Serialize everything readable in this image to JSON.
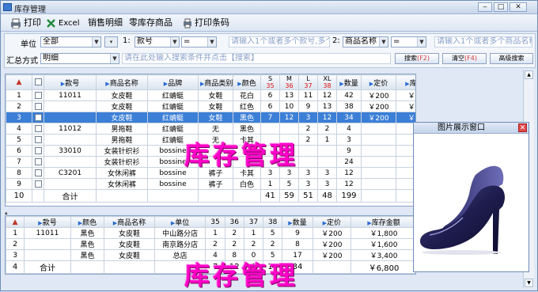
{
  "window": {
    "title": "库存管理",
    "min": "‒",
    "max": "□",
    "close": "✕"
  },
  "toolbar": {
    "print": "打印",
    "excel": "Excel",
    "sales_detail": "销售明细",
    "zero_stock": "零库存商品",
    "print_barcode": "打印条码"
  },
  "filters": {
    "unit_label": "单位",
    "unit_value": "全部",
    "unit_extra": "▾",
    "cond1_index": "1:",
    "cond1_field": "款号",
    "cond1_op": "=",
    "cond1_placeholder": "请输入1个或者多个款号,多个",
    "cond2_index": "2:",
    "cond2_field": "商品名称",
    "cond2_op": "=",
    "cond2_placeholder": "请输入1个或者多个商品名称",
    "summary_label": "汇总方式",
    "summary_value": "明细",
    "summary_placeholder": "请在此处输入搜索条件并点击【搜索】",
    "search_btn": "搜索",
    "search_key": "(F2)",
    "clear_btn": "清空",
    "clear_key": "(F4)",
    "advanced_btn": "高级搜索"
  },
  "top_grid": {
    "headers": {
      "style": "款号",
      "name": "商品名称",
      "brand": "品牌",
      "category": "商品类别",
      "color": "颜色",
      "qty": "数量",
      "price": "定价",
      "amount": "库存金额"
    },
    "size_headers": [
      {
        "label": "S",
        "num": "35"
      },
      {
        "label": "M",
        "num": "36"
      },
      {
        "label": "L",
        "num": "37"
      },
      {
        "label": "XL",
        "num": "38"
      }
    ],
    "rows": [
      {
        "n": "1",
        "style": "11011",
        "name": "女皮鞋",
        "brand": "红蜻蜓",
        "category": "女鞋",
        "color": "花白",
        "s": "6",
        "m": "13",
        "l": "11",
        "xl": "12",
        "qty": "42",
        "price": "￥200",
        "amount": "￥8,400"
      },
      {
        "n": "2",
        "style": "",
        "name": "女皮鞋",
        "brand": "红蜻蜓",
        "category": "女鞋",
        "color": "红色",
        "s": "6",
        "m": "10",
        "l": "9",
        "xl": "13",
        "qty": "38",
        "price": "￥200",
        "amount": "￥7,600"
      },
      {
        "n": "3",
        "style": "",
        "name": "女皮鞋",
        "brand": "红蜻蜓",
        "category": "女鞋",
        "color": "黑色",
        "s": "7",
        "m": "12",
        "l": "3",
        "xl": "12",
        "qty": "34",
        "price": "￥200",
        "amount": "￥6,800"
      },
      {
        "n": "4",
        "style": "11012",
        "name": "男拖鞋",
        "brand": "红蜻蜓",
        "category": "无",
        "color": "黑色",
        "s": "",
        "m": "",
        "l": "2",
        "xl": "2",
        "qty": "4",
        "price": "",
        "amount": ""
      },
      {
        "n": "5",
        "style": "",
        "name": "男拖鞋",
        "brand": "红蜻蜓",
        "category": "无",
        "color": "卡其",
        "s": "",
        "m": "",
        "l": "2",
        "xl": "1",
        "qty": "3",
        "price": "",
        "amount": ""
      },
      {
        "n": "6",
        "style": "33010",
        "name": "女装针织衫",
        "brand": "bossine",
        "category": "",
        "color": "",
        "s": "",
        "m": "",
        "l": "",
        "xl": "",
        "qty": "9",
        "price": "",
        "amount": ""
      },
      {
        "n": "7",
        "style": "",
        "name": "女装针织衫",
        "brand": "bossine",
        "category": "",
        "color": "",
        "s": "",
        "m": "",
        "l": "",
        "xl": "",
        "qty": "24",
        "price": "",
        "amount": ""
      },
      {
        "n": "8",
        "style": "C3201",
        "name": "女休闲裤",
        "brand": "bossine",
        "category": "裤子",
        "color": "卡其",
        "s": "3",
        "m": "3",
        "l": "3",
        "xl": "3",
        "qty": "12",
        "price": "",
        "amount": ""
      },
      {
        "n": "9",
        "style": "",
        "name": "女休闲裤",
        "brand": "bossine",
        "category": "裤子",
        "color": "白色",
        "s": "1",
        "m": "5",
        "l": "3",
        "xl": "3",
        "qty": "12",
        "price": "",
        "amount": ""
      },
      {
        "n": "10",
        "style": "合计",
        "name": "",
        "brand": "",
        "category": "",
        "color": "",
        "s": "41",
        "m": "59",
        "l": "51",
        "xl": "48",
        "qty": "199",
        "price": "",
        "amount": ""
      }
    ]
  },
  "bottom_grid": {
    "headers": {
      "style": "款号",
      "color": "颜色",
      "name": "商品名称",
      "unit": "单位",
      "s35": "35",
      "s36": "36",
      "s37": "37",
      "s38": "38",
      "qty": "数量",
      "price": "定价",
      "amount": "库存金额"
    },
    "rows": [
      {
        "n": "1",
        "style": "11011",
        "color": "黑色",
        "name": "女皮鞋",
        "unit": "中山路分店",
        "s35": "1",
        "s36": "2",
        "s37": "1",
        "s38": "5",
        "qty": "9",
        "price": "￥200",
        "amount": "￥1,800"
      },
      {
        "n": "2",
        "style": "",
        "color": "黑色",
        "name": "女皮鞋",
        "unit": "南京路分店",
        "s35": "2",
        "s36": "2",
        "s37": "2",
        "s38": "2",
        "qty": "8",
        "price": "￥200",
        "amount": "￥1,600"
      },
      {
        "n": "3",
        "style": "",
        "color": "黑色",
        "name": "女皮鞋",
        "unit": "总店",
        "s35": "4",
        "s36": "8",
        "s37": "0",
        "s38": "5",
        "qty": "17",
        "price": "￥200",
        "amount": "￥3,400"
      },
      {
        "n": "4",
        "style": "合计",
        "color": "",
        "name": "",
        "unit": "",
        "s35": "7",
        "s36": "12",
        "s37": "3",
        "s38": "12",
        "qty": "34",
        "price": "",
        "amount": "￥6,800"
      }
    ]
  },
  "popup": {
    "title": "图片展示窗口",
    "close": "✕"
  },
  "overlay_text": "库存管理"
}
